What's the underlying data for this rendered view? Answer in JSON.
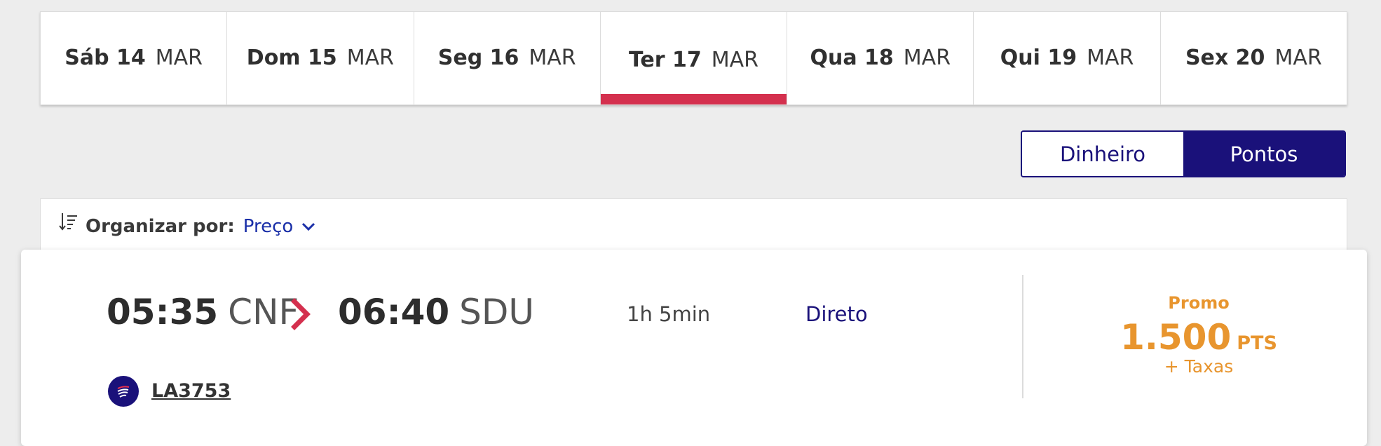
{
  "dates": [
    {
      "day": "Sáb 14",
      "month": "MAR",
      "active": false
    },
    {
      "day": "Dom 15",
      "month": "MAR",
      "active": false
    },
    {
      "day": "Seg 16",
      "month": "MAR",
      "active": false
    },
    {
      "day": "Ter 17",
      "month": "MAR",
      "active": true
    },
    {
      "day": "Qua 18",
      "month": "MAR",
      "active": false
    },
    {
      "day": "Qui 19",
      "month": "MAR",
      "active": false
    },
    {
      "day": "Sex 20",
      "month": "MAR",
      "active": false
    }
  ],
  "currency_toggle": {
    "money_label": "Dinheiro",
    "points_label": "Pontos",
    "selected": "Pontos"
  },
  "sort": {
    "label": "Organizar por:",
    "value": "Preço",
    "icon": "sort-icon"
  },
  "flight": {
    "departure_time": "05:35",
    "departure_airport": "CNF",
    "arrival_time": "06:40",
    "arrival_airport": "SDU",
    "duration": "1h 5min",
    "stops": "Direto",
    "promo_label": "Promo",
    "price": "1.500",
    "price_unit": "PTS",
    "fees": "+ Taxas",
    "flight_number": "LA3753",
    "airline_logo": "latam-logo-icon"
  },
  "colors": {
    "accent_red": "#d4304e",
    "brand_navy": "#1a117a",
    "price_orange": "#e8952e",
    "link_blue": "#1a2fa8",
    "background": "#ededed"
  }
}
